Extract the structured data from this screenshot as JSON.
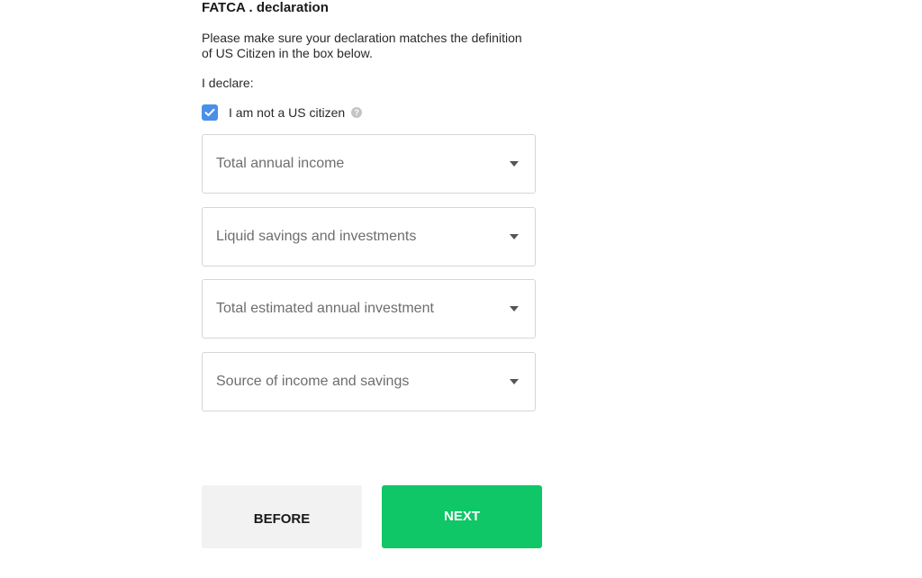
{
  "section": {
    "title": "FATCA . declaration",
    "intro": "Please make sure your declaration matches the definition of US Citizen in the box below.",
    "declare_label": "I declare:"
  },
  "checkbox": {
    "label": "I am not a US citizen",
    "checked": true,
    "help_icon": "question-mark-icon",
    "help_glyph": "?"
  },
  "selects": [
    {
      "placeholder": "Total annual income"
    },
    {
      "placeholder": "Liquid savings and investments"
    },
    {
      "placeholder": "Total estimated annual investment"
    },
    {
      "placeholder": "Source of income and savings"
    }
  ],
  "buttons": {
    "before_label": "BEFORE",
    "next_label": "NEXT"
  },
  "colors": {
    "accent_checkbox": "#4a8fe8",
    "primary_button": "#0fc766",
    "secondary_button": "#f2f2f2"
  }
}
